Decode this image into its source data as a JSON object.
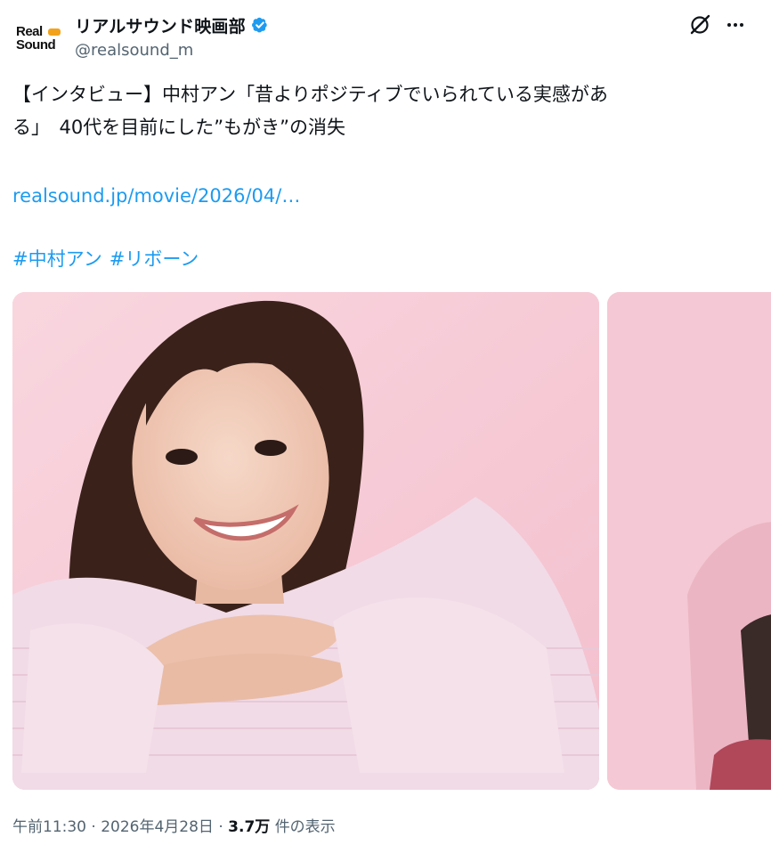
{
  "account": {
    "avatar_line1": "Real",
    "avatar_line2": "Sound",
    "display_name": "リアルサウンド映画部",
    "handle": "@realsound_m"
  },
  "tweet": {
    "text_line1": "【インタビュー】中村アン「昔よりポジティブでいられている実感があ",
    "text_line2": "る」　40代を目前にした”もがき”の消失",
    "link": "realsound.jp/movie/2026/04/…",
    "hashtags": [
      "#中村アン",
      "#リボーン"
    ]
  },
  "meta": {
    "time": "午前11:30",
    "separator1": "·",
    "date": "2026年4月28日",
    "separator2": "·",
    "views_count": "3.7万",
    "views_label": "件の表示"
  },
  "colors": {
    "link": "#1d9bf0",
    "verified": "#1d9bf0",
    "secondary_text": "#536471",
    "photo_background": "#f6c9d6"
  },
  "icons": {
    "verified": "verified-badge-icon",
    "grok": "grok-icon",
    "more": "more-options-icon"
  },
  "media": {
    "images": [
      {
        "name": "photo-1",
        "subject": "portrait on pink background"
      },
      {
        "name": "photo-2",
        "subject": "partial portrait on pink background"
      }
    ]
  }
}
